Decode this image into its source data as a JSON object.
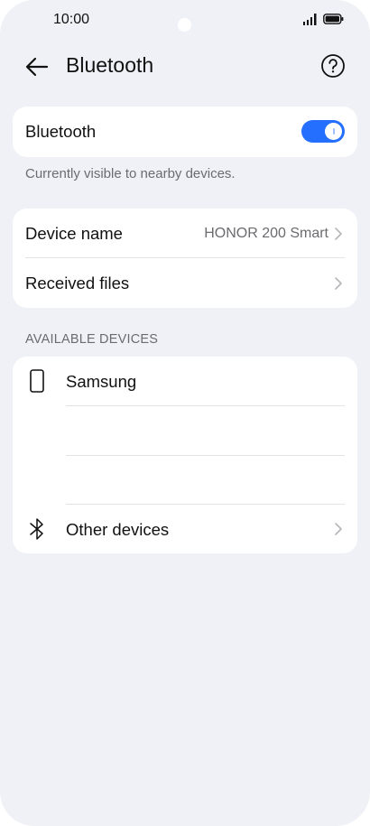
{
  "status_bar": {
    "time": "10:00"
  },
  "header": {
    "title": "Bluetooth"
  },
  "bluetooth_toggle": {
    "label": "Bluetooth",
    "state": "on",
    "accent": "#256fff"
  },
  "visibility_caption": "Currently visible to nearby devices.",
  "settings": {
    "device_name_label": "Device name",
    "device_name_value": "HONOR 200 Smart",
    "received_files_label": "Received files"
  },
  "available": {
    "section_title": "AVAILABLE DEVICES",
    "devices": [
      {
        "name": "Samsung",
        "icon": "phone-icon"
      }
    ],
    "other_label": "Other devices",
    "other_icon": "bluetooth-icon"
  }
}
